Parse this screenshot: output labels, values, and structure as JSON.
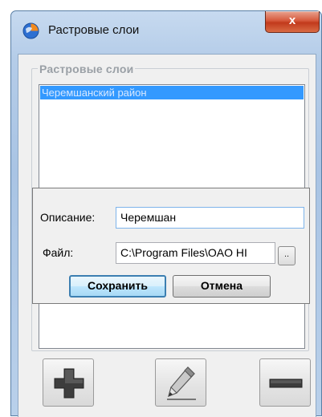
{
  "window": {
    "title": "Растровые слои",
    "close_label": "x",
    "icon": "app-globe-icon"
  },
  "group": {
    "caption": "Растровые слои",
    "items": [
      {
        "label": "Черемшанский район",
        "selected": true
      }
    ]
  },
  "dialog": {
    "description_label": "Описание:",
    "description_value": "Черемшан",
    "file_label": "Файл:",
    "file_value": "C:\\Program Files\\OAO HI",
    "browse_label": "..",
    "save_label": "Сохранить",
    "cancel_label": "Отмена"
  },
  "toolbar": {
    "add_icon": "plus-icon",
    "edit_icon": "pencil-icon",
    "remove_icon": "minus-icon"
  },
  "colors": {
    "selection": "#3399ff",
    "close_button": "#c23a1c",
    "default_button_border": "#3c7fb1"
  }
}
